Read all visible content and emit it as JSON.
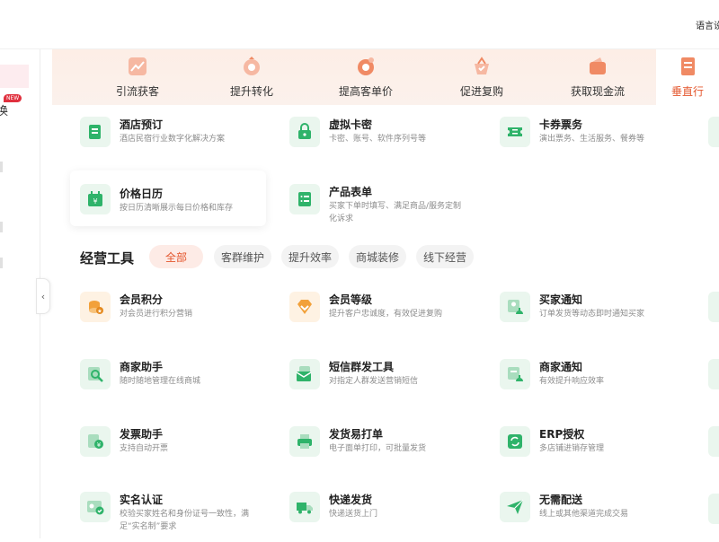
{
  "top": {
    "lang_label": "语言设置"
  },
  "sidebar": {
    "new_badge": "NEW",
    "partial_label": "换"
  },
  "tabs": [
    {
      "label": "引流获客",
      "icon": "trend-icon"
    },
    {
      "label": "提升转化",
      "icon": "funnel-icon"
    },
    {
      "label": "提高客单价",
      "icon": "coin-icon"
    },
    {
      "label": "促进复购",
      "icon": "basket-icon"
    },
    {
      "label": "获取现金流",
      "icon": "wallet-icon"
    },
    {
      "label": "垂直行",
      "icon": "document-icon"
    }
  ],
  "vertical_cards": [
    {
      "title": "酒店预订",
      "desc": "酒店民宿行业数字化解决方案",
      "icon": "hotel-icon"
    },
    {
      "title": "虚拟卡密",
      "desc": "卡密、账号、软件序列号等",
      "icon": "lock-icon"
    },
    {
      "title": "卡券票务",
      "desc": "演出票务、生活服务、餐券等",
      "icon": "ticket-icon"
    },
    {
      "title": "价格日历",
      "desc": "按日历清晰展示每日价格和库存",
      "icon": "calendar-icon"
    },
    {
      "title": "产品表单",
      "desc": "买家下单时填写、满足商品/服务定制化诉求",
      "icon": "form-icon"
    }
  ],
  "tools": {
    "title": "经营工具",
    "filters": [
      "全部",
      "客群维护",
      "提升效率",
      "商城装修",
      "线下经营"
    ],
    "items": [
      {
        "title": "会员积分",
        "desc": "对会员进行积分营销",
        "icon": "points-icon"
      },
      {
        "title": "会员等级",
        "desc": "提升客户忠诚度，有效促进复购",
        "icon": "diamond-icon"
      },
      {
        "title": "买家通知",
        "desc": "订单发货等动态即时通知买家",
        "icon": "bell-icon"
      },
      {
        "title": "商家助手",
        "desc": "随时随地管理在线商城",
        "icon": "search-doc-icon"
      },
      {
        "title": "短信群发工具",
        "desc": "对指定人群发送营销短信",
        "icon": "mail-icon"
      },
      {
        "title": "商家通知",
        "desc": "有效提升响应效率",
        "icon": "notice-icon"
      },
      {
        "title": "发票助手",
        "desc": "支持自动开票",
        "icon": "invoice-icon"
      },
      {
        "title": "发货易打单",
        "desc": "电子面单打印，可批量发货",
        "icon": "printer-icon"
      },
      {
        "title": "ERP授权",
        "desc": "多店铺进销存管理",
        "icon": "sync-icon"
      },
      {
        "title": "实名认证",
        "desc": "校验买家姓名和身份证号一致性，满足“实名制”要求",
        "icon": "id-card-icon"
      },
      {
        "title": "快递发货",
        "desc": "快递送货上门",
        "icon": "truck-icon"
      },
      {
        "title": "无需配送",
        "desc": "线上或其他渠道完成交易",
        "icon": "paper-plane-icon"
      }
    ]
  },
  "colors": {
    "accent": "#e4572e",
    "green": "#2fb36a",
    "orange": "#f2a13a"
  }
}
